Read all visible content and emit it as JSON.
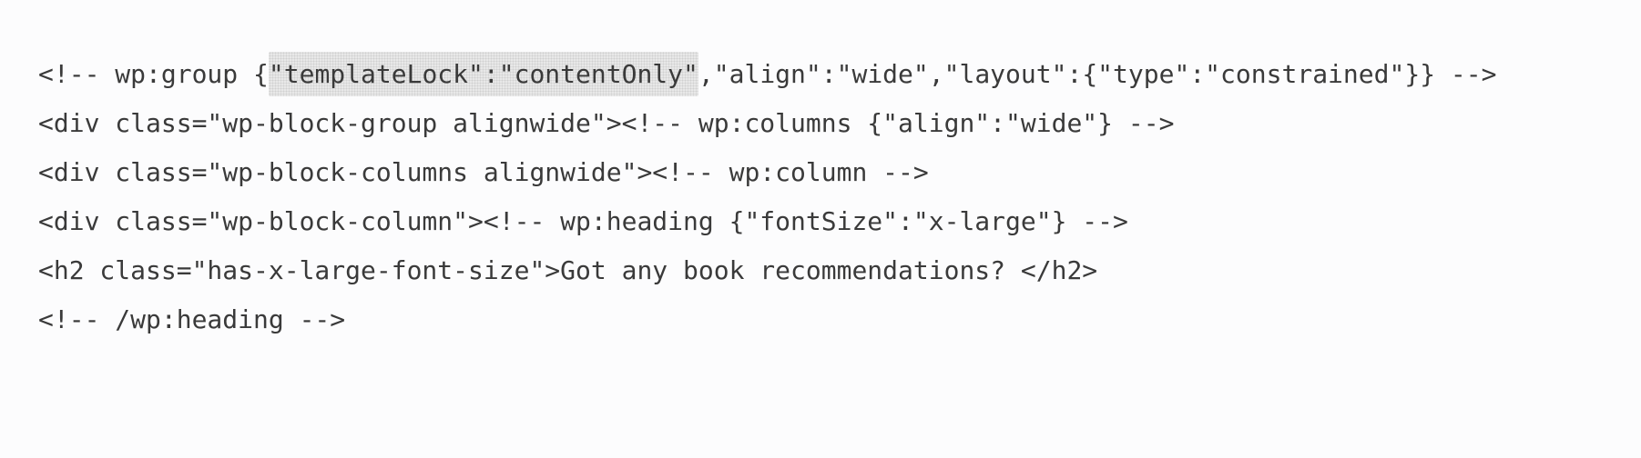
{
  "code": {
    "line1": {
      "before": "<!-- wp:group {",
      "highlighted": "\"templateLock\":\"contentOnly\"",
      "after": ",\"align\":\"wide\",\"layout\":{\"type\":\"constrained\"}} -->"
    },
    "line2": "<div class=\"wp-block-group alignwide\"><!-- wp:columns {\"align\":\"wide\"} -->",
    "line3": "<div class=\"wp-block-columns alignwide\"><!-- wp:column -->",
    "line4": "<div class=\"wp-block-column\"><!-- wp:heading {\"fontSize\":\"x-large\"} -->",
    "line5": "<h2 class=\"has-x-large-font-size\">Got any book recommendations? </h2>",
    "line6": "<!-- /wp:heading -->"
  }
}
